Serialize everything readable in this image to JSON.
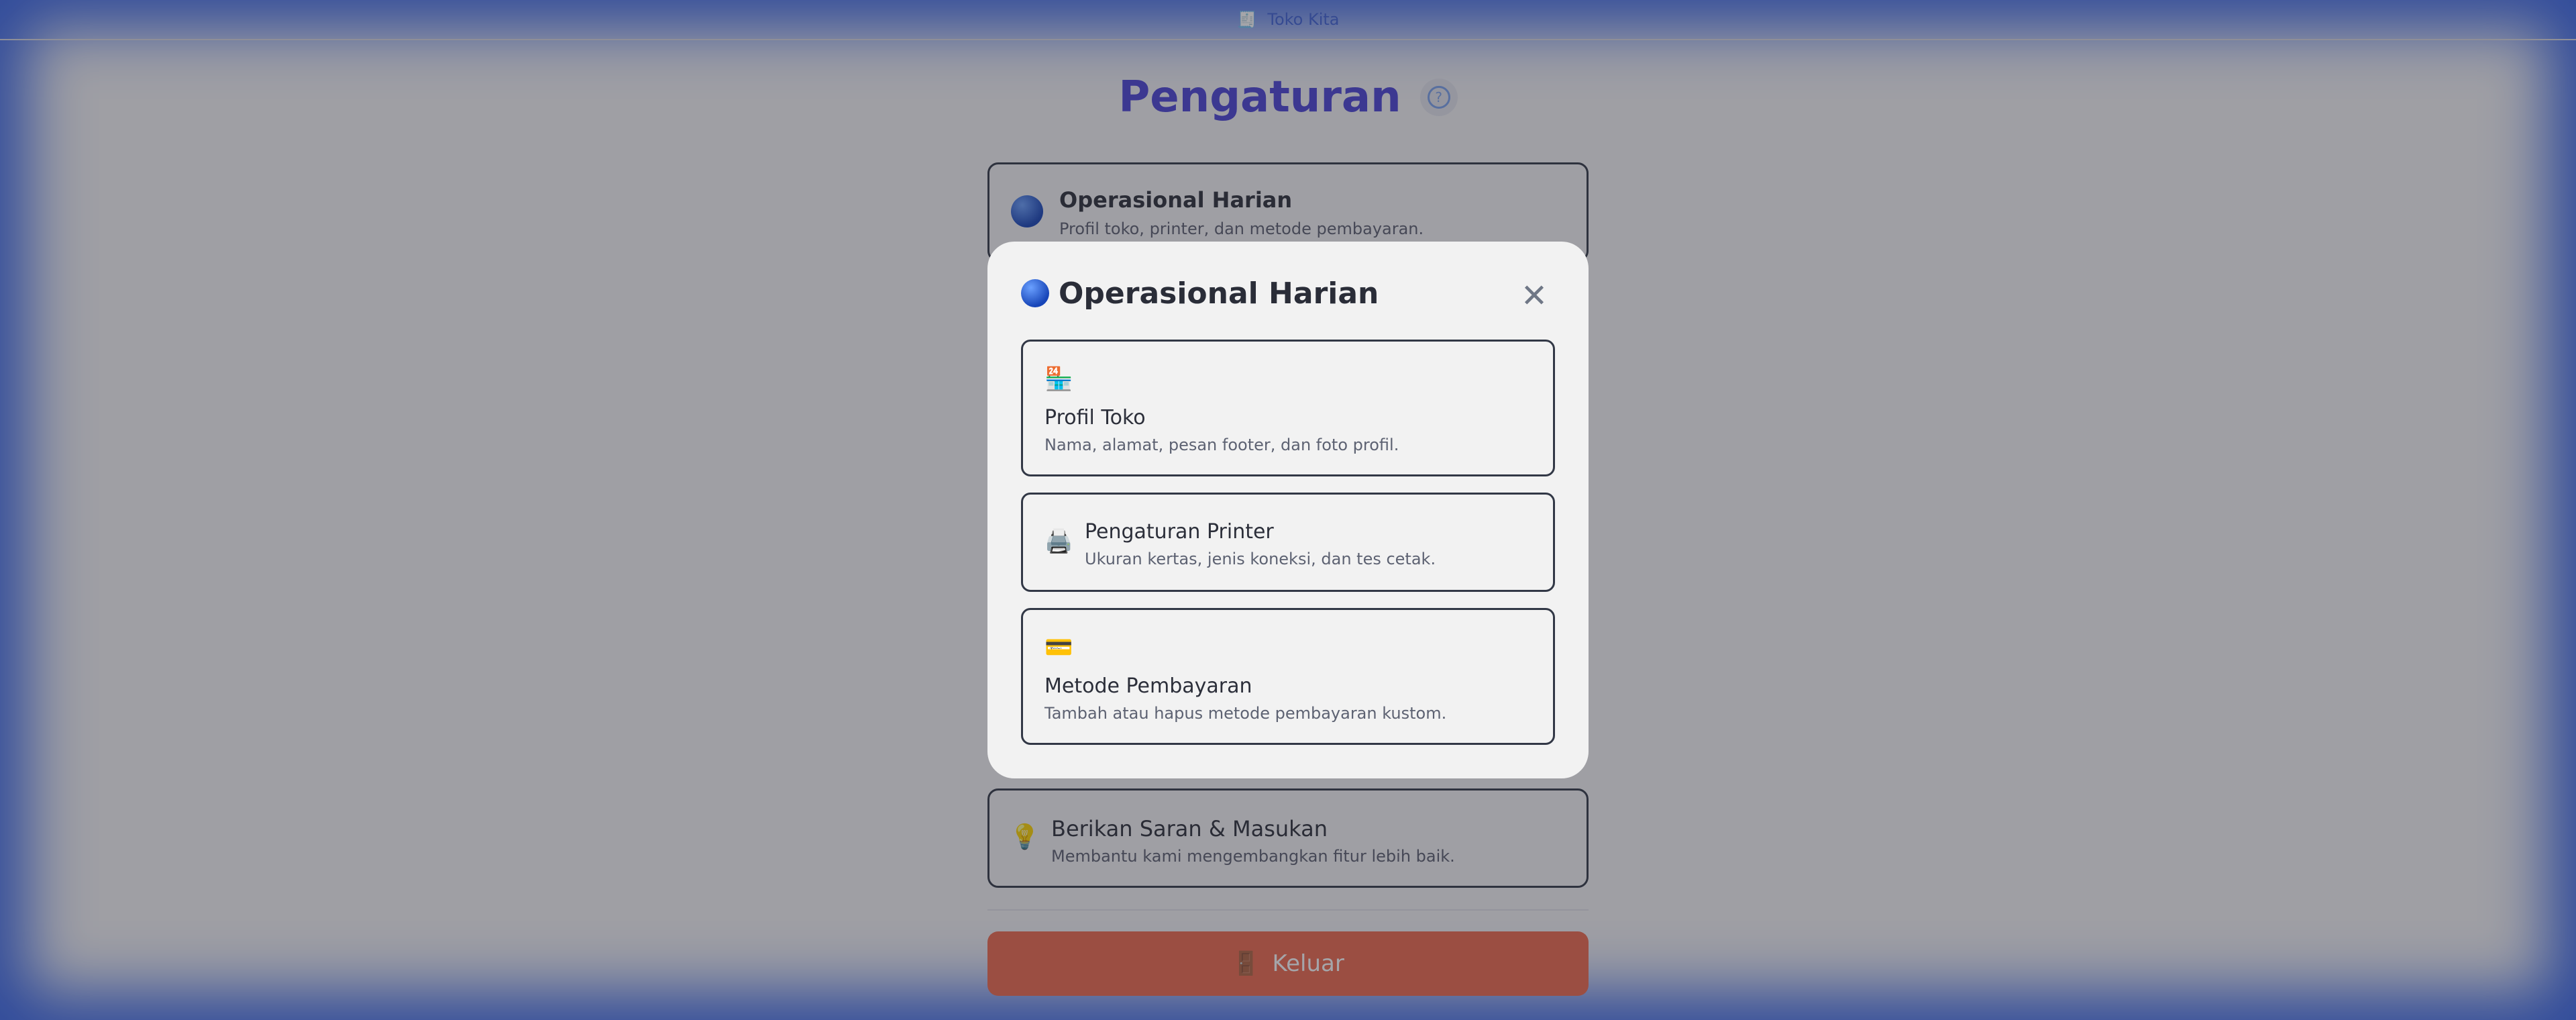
{
  "header": {
    "brand": "Toko Kita",
    "icon": "receipt-icon"
  },
  "page": {
    "title": "Pengaturan",
    "help_icon": "help-icon",
    "help_glyph": "?"
  },
  "cards": {
    "operational": {
      "title": "Operasional Harian",
      "description": "Profil toko, printer, dan metode pembayaran.",
      "icon": "globe-icon"
    },
    "feedback": {
      "title": "Berikan Saran & Masukan",
      "description": "Membantu kami mengembangkan fitur lebih baik.",
      "icon": "lightbulb-icon",
      "glyph": "💡"
    }
  },
  "logout": {
    "label": "Keluar",
    "icon": "door-icon",
    "glyph": "🚪"
  },
  "modal": {
    "title": "Operasional Harian",
    "close_glyph": "✕",
    "options": [
      {
        "title": "Profil Toko",
        "description": "Nama, alamat, pesan footer, dan foto profil.",
        "icon": "store-icon",
        "glyph": "🏪"
      },
      {
        "title": "Pengaturan Printer",
        "description": "Ukuran kertas, jenis koneksi, dan tes cetak.",
        "icon": "printer-icon",
        "glyph": "🖨️"
      },
      {
        "title": "Metode Pembayaran",
        "description": "Tambah atau hapus metode pembayaran kustom.",
        "icon": "credit-card-icon",
        "glyph": "💳"
      }
    ]
  },
  "colors": {
    "accent": "#4b44d6",
    "logout": "#ee6a4e",
    "frame_glow": "#3563e6"
  }
}
